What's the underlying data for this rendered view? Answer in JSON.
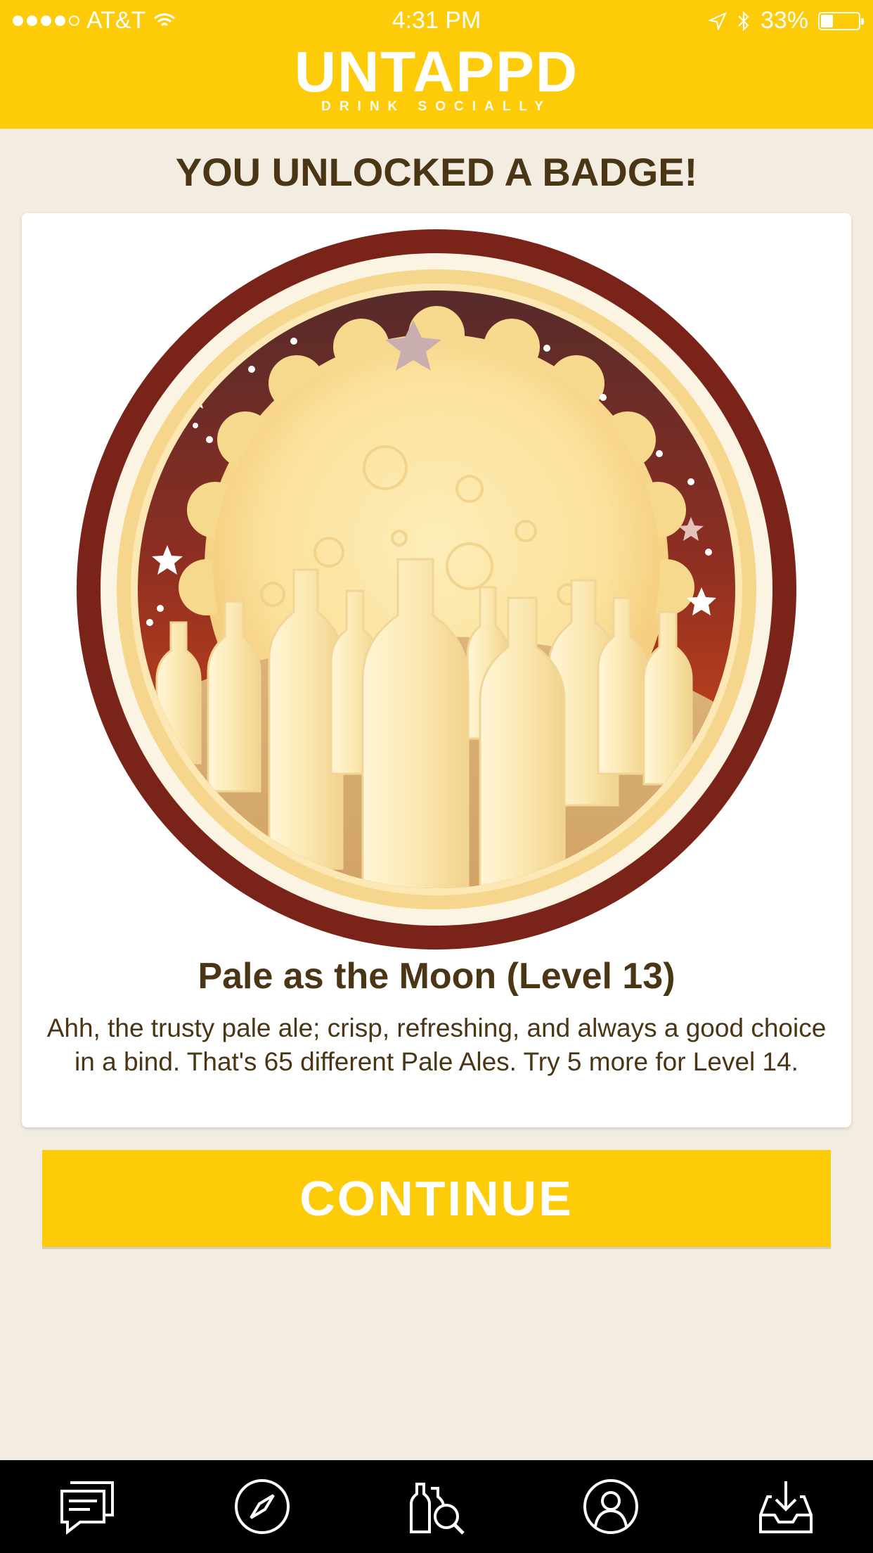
{
  "status_bar": {
    "carrier": "AT&T",
    "time": "4:31 PM",
    "battery": "33%",
    "battery_level": 0.33
  },
  "header": {
    "logo": "UNTAPPD",
    "tagline": "DRINK SOCIALLY",
    "background": "#fdcb08"
  },
  "page": {
    "title": "YOU UNLOCKED A BADGE!"
  },
  "badge": {
    "name": "Pale as the Moon (Level 13)",
    "description": "Ahh, the trusty pale ale; crisp, refreshing, and always a good choice in a bind. That's 65 different Pale Ales. Try 5 more for Level 14.",
    "image": "pale-moon-badge-icon"
  },
  "actions": {
    "continue_label": "CONTINUE"
  },
  "tabbar": {
    "items": [
      {
        "icon": "activity-feed-icon"
      },
      {
        "icon": "discover-compass-icon"
      },
      {
        "icon": "beer-search-icon"
      },
      {
        "icon": "profile-icon"
      },
      {
        "icon": "inbox-icon"
      }
    ]
  },
  "colors": {
    "accent": "#fdcb08",
    "text": "#4a3515",
    "background": "#f3ece1"
  }
}
